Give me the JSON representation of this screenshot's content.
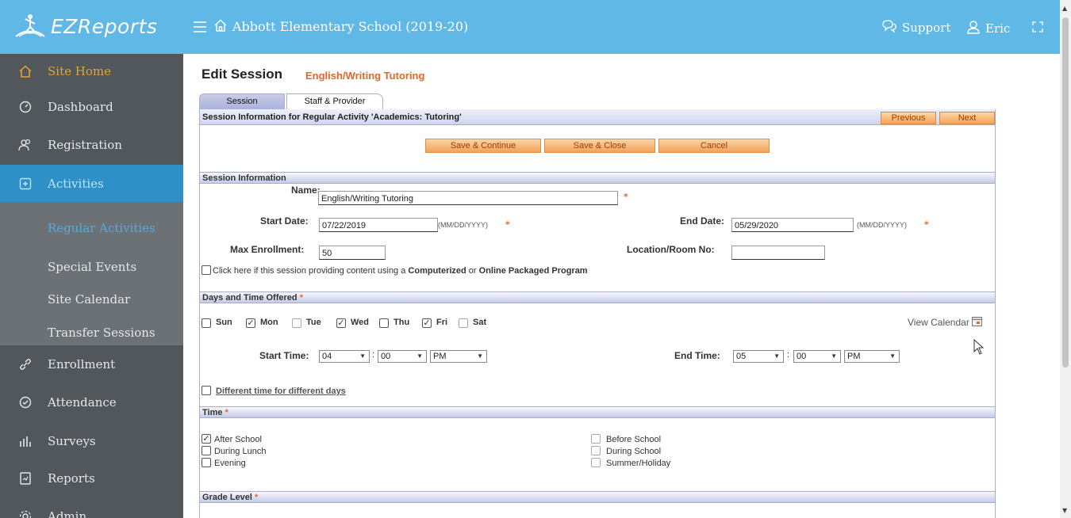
{
  "topbar": {
    "app_name": "EZReports",
    "school": "Abbott Elementary School (2019-20)",
    "support_label": "Support",
    "user_label": "Eric"
  },
  "sidebar": {
    "items": [
      {
        "label": "Site Home",
        "icon": "home-icon"
      },
      {
        "label": "Dashboard",
        "icon": "dashboard-icon"
      },
      {
        "label": "Registration",
        "icon": "users-icon"
      },
      {
        "label": "Activities",
        "icon": "activities-icon"
      },
      {
        "label": "Enrollment",
        "icon": "link-icon"
      },
      {
        "label": "Attendance",
        "icon": "check-circle-icon"
      },
      {
        "label": "Surveys",
        "icon": "bar-chart-icon"
      },
      {
        "label": "Reports",
        "icon": "report-icon"
      },
      {
        "label": "Admin",
        "icon": "admin-icon"
      }
    ],
    "sub_items": [
      {
        "label": "Regular Activities"
      },
      {
        "label": "Special Events"
      },
      {
        "label": "Site Calendar"
      },
      {
        "label": "Transfer Sessions"
      }
    ]
  },
  "page": {
    "title": "Edit Session",
    "subtitle": "English/Writing Tutoring"
  },
  "tabs": [
    {
      "label": "Session"
    },
    {
      "label": "Staff & Provider"
    }
  ],
  "frame": {
    "header": "Session Information for Regular Activity 'Academics: Tutoring'",
    "previous_label": "Previous",
    "next_label": "Next",
    "save_continue_label": "Save & Continue",
    "save_close_label": "Save & Close",
    "cancel_label": "Cancel"
  },
  "session_info": {
    "section_title": "Session Information",
    "name_label": "Name:",
    "name_value": "English/Writing Tutoring",
    "start_date_label": "Start Date:",
    "start_date_value": "07/22/2019",
    "start_date_hint": "(MM/DD/YYYY)",
    "end_date_label": "End Date:",
    "end_date_value": "05/29/2020",
    "end_date_hint": "(MM/DD/YYYY)",
    "max_enrollment_label": "Max Enrollment:",
    "max_enrollment_value": "50",
    "location_label": "Location/Room No:",
    "location_value": "",
    "computerized_text_prefix": "Click here if this session providing content using a ",
    "computerized_bold1": "Computerized",
    "computerized_or": " or ",
    "computerized_bold2": "Online Packaged Program",
    "required_mark": "*"
  },
  "days": {
    "section_title": "Days and Time Offered",
    "items": [
      {
        "label": "Sun",
        "checked": false
      },
      {
        "label": "Mon",
        "checked": true
      },
      {
        "label": "Tue",
        "checked": false
      },
      {
        "label": "Wed",
        "checked": true
      },
      {
        "label": "Thu",
        "checked": false
      },
      {
        "label": "Fri",
        "checked": true
      },
      {
        "label": "Sat",
        "checked": false
      }
    ],
    "view_calendar_label": "View Calendar",
    "start_time_label": "Start Time:",
    "start_hour": "04",
    "start_min": "00",
    "start_ampm": "PM",
    "end_time_label": "End Time:",
    "end_hour": "05",
    "end_min": "00",
    "end_ampm": "PM",
    "time_sep": ":",
    "different_time_label": "Different time for different days"
  },
  "time": {
    "section_title": "Time",
    "options": [
      {
        "label": "After School",
        "checked": true
      },
      {
        "label": "During Lunch",
        "checked": false
      },
      {
        "label": "Evening",
        "checked": false
      },
      {
        "label": "Before School",
        "checked": false
      },
      {
        "label": "During School",
        "checked": false
      },
      {
        "label": "Summer/Holiday",
        "checked": false
      }
    ]
  },
  "grade": {
    "section_title": "Grade Level"
  },
  "colors": {
    "topbar": "#5fb8e6",
    "sidebar": "#52575b",
    "accent_orange": "#e9652b",
    "active_blue": "#2f8fc7"
  }
}
